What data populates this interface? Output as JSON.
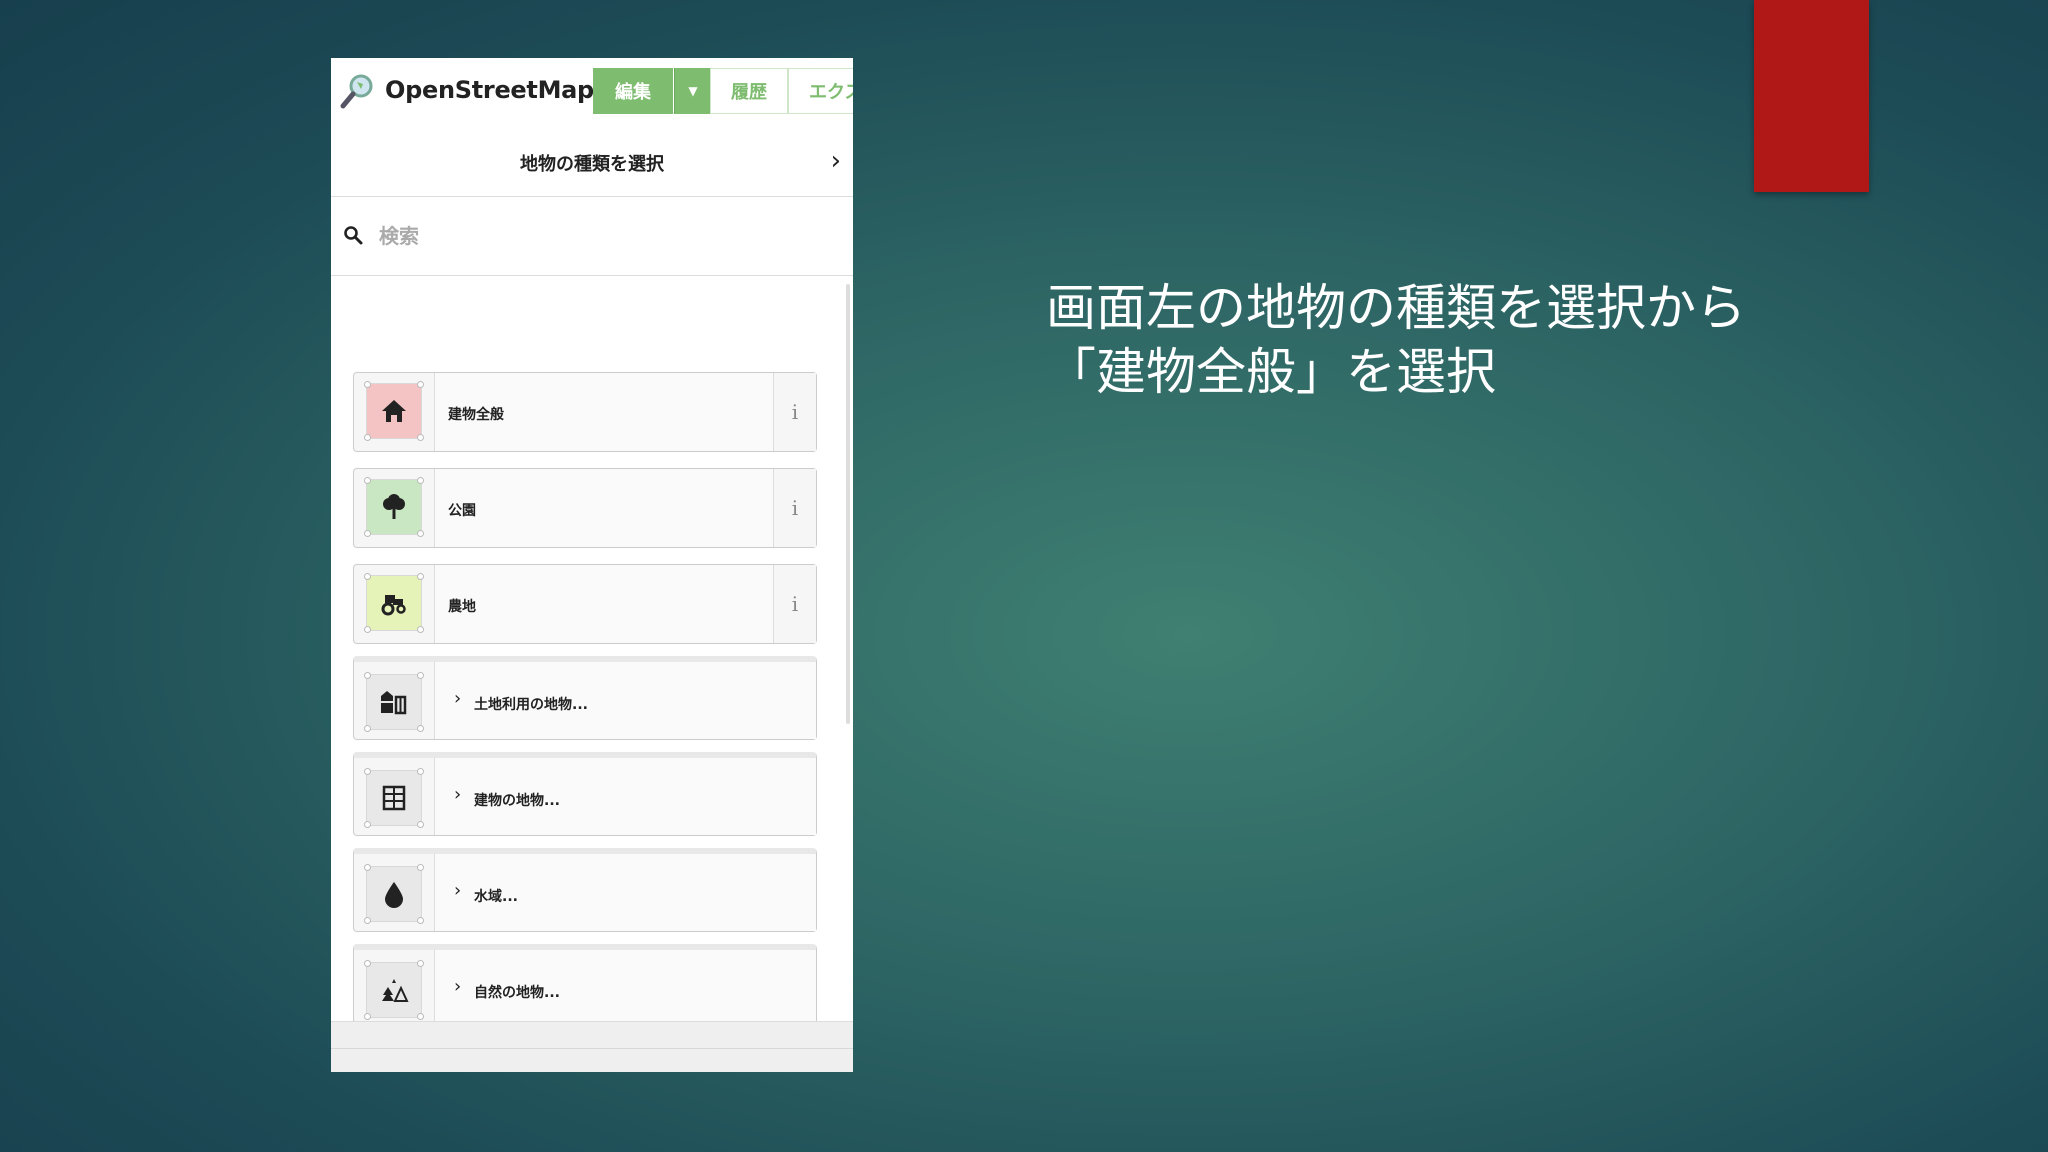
{
  "slide": {
    "caption_lines": [
      "画面左の地物の種類を選択から",
      "「建物全般」を選択"
    ],
    "accent_color": "#b01818"
  },
  "app": {
    "brand": "OpenStreetMap",
    "tabs": {
      "edit": "編集",
      "history": "履歴",
      "export": "エクス"
    }
  },
  "panel": {
    "title": "地物の種類を選択",
    "search_placeholder": "検索"
  },
  "items": [
    {
      "label": "建物全般",
      "icon": "house-icon",
      "color": "#f4c4c4",
      "info": "i"
    },
    {
      "label": "公園",
      "icon": "tree-icon",
      "color": "#c9e7c2",
      "info": "i"
    },
    {
      "label": "農地",
      "icon": "tractor-icon",
      "color": "#e5f2b8",
      "info": "i"
    }
  ],
  "categories": [
    {
      "label": "土地利用の地物...",
      "icon": "landuse-icon"
    },
    {
      "label": "建物の地物...",
      "icon": "building-grid-icon"
    },
    {
      "label": "水域...",
      "icon": "water-drop-icon"
    },
    {
      "label": "自然の地物...",
      "icon": "nature-icon"
    }
  ]
}
